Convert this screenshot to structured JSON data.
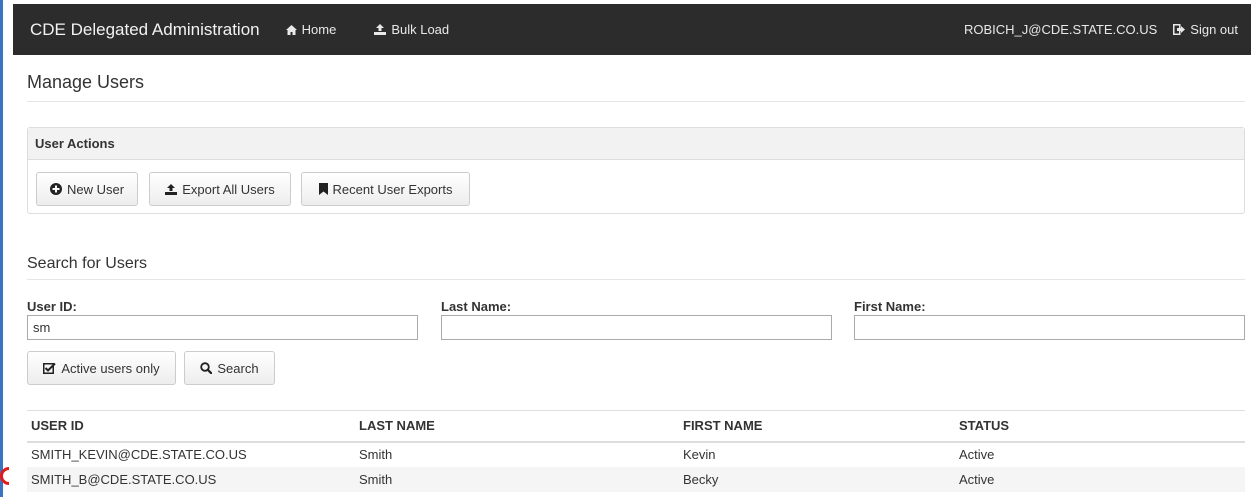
{
  "navbar": {
    "brand": "CDE Delegated Administration",
    "home_label": "Home",
    "bulk_load_label": "Bulk Load",
    "user_email": "ROBICH_J@CDE.STATE.CO.US",
    "sign_out_label": "Sign out",
    "bg_color": "#2c2c2c"
  },
  "page": {
    "title": "Manage Users"
  },
  "user_actions": {
    "title": "User Actions",
    "new_user_label": "New User",
    "export_all_label": "Export All Users",
    "recent_exports_label": "Recent User Exports"
  },
  "search": {
    "title": "Search for Users",
    "user_id_label": "User ID:",
    "user_id_value": "sm",
    "last_name_label": "Last Name:",
    "last_name_value": "",
    "first_name_label": "First Name:",
    "first_name_value": "",
    "active_only_label": "Active users only",
    "search_label": "Search"
  },
  "table": {
    "headers": [
      "USER ID",
      "LAST NAME",
      "FIRST NAME",
      "STATUS"
    ],
    "rows": [
      [
        "SMITH_KEVIN@CDE.STATE.CO.US",
        "Smith",
        "Kevin",
        "Active"
      ],
      [
        "SMITH_B@CDE.STATE.CO.US",
        "Smith",
        "Becky",
        "Active"
      ]
    ]
  },
  "icons": {
    "home": "home-icon",
    "bulk_load": "upload-icon",
    "sign_out": "sign-out-icon",
    "new_user": "plus-circle-icon",
    "export": "upload-icon",
    "recent": "bookmark-icon",
    "active": "checkbox-checked-icon",
    "search": "search-icon"
  }
}
